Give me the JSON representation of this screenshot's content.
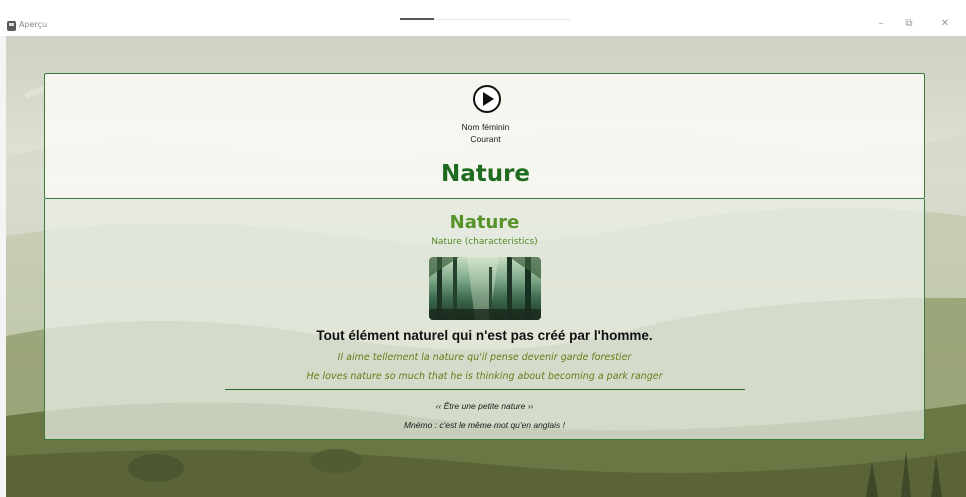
{
  "window": {
    "title": "Aperçu",
    "minimize_symbol": "–",
    "restore_symbol": "⧉",
    "close_symbol": "✕"
  },
  "entry": {
    "gender": "Nom féminin",
    "register": "Courant",
    "headword": "Nature",
    "sense": {
      "title": "Nature",
      "subtitle": "Nature (characteristics)",
      "definition": "Tout élément naturel qui n'est pas créé par l'homme.",
      "example_fr": "Il aime tellement la nature qu'il pense devenir garde forestier",
      "example_en": "He loves nature so much that he is thinking about becoming a park ranger",
      "expression": "‹‹ Être une petite nature ››",
      "mnemonic": "Mnémo : c'est le même mot qu'en anglais !"
    }
  }
}
